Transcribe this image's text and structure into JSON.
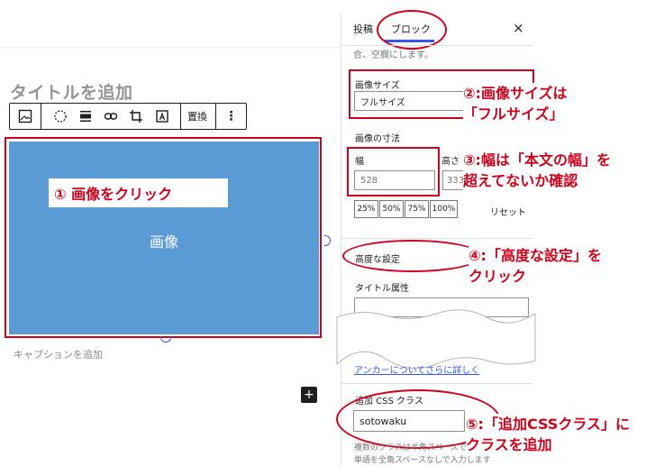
{
  "editor": {
    "title_placeholder": "タイトルを追加",
    "toolbar": {
      "replace_label": "置換",
      "more_label": "⋮"
    },
    "image_label": "画像",
    "caption_placeholder": "キャプションを追加",
    "add_block": "+"
  },
  "sidebar": {
    "tabs": {
      "post": "投稿",
      "block": "ブロック"
    },
    "close": "×",
    "cut_text": "合、空欄にします。",
    "image_size": {
      "label": "画像サイズ",
      "value": "フルサイズ"
    },
    "dimensions": {
      "label": "画像の寸法",
      "width_label": "幅",
      "width_value": "528",
      "height_label": "高さ",
      "height_value": "333",
      "percent_buttons": [
        "25%",
        "50%",
        "75%",
        "100%"
      ],
      "reset": "リセット"
    },
    "advanced": {
      "label": "高度な設定"
    },
    "title_attr": {
      "label": "タイトル属性",
      "value": ""
    },
    "anchor_link": "アンカーについてさらに詳しく",
    "css_class": {
      "label": "追加 CSS クラス",
      "value": "sotowaku"
    },
    "help_line1": "複数のクラスは半角スペースで",
    "help_line2": "単語を全角スペースなしで入力します"
  },
  "annotations": {
    "n1": "① 画像をクリック",
    "n2a": "②:画像サイズは",
    "n2b": "「フルサイズ」",
    "n3a": "③:幅は「本文の幅」を",
    "n3b": "超えてないか確認",
    "n4a": "④:「高度な設定」を",
    "n4b": "クリック",
    "n5a": "⑤:「追加CSSクラス」に",
    "n5b": "クラスを追加"
  }
}
